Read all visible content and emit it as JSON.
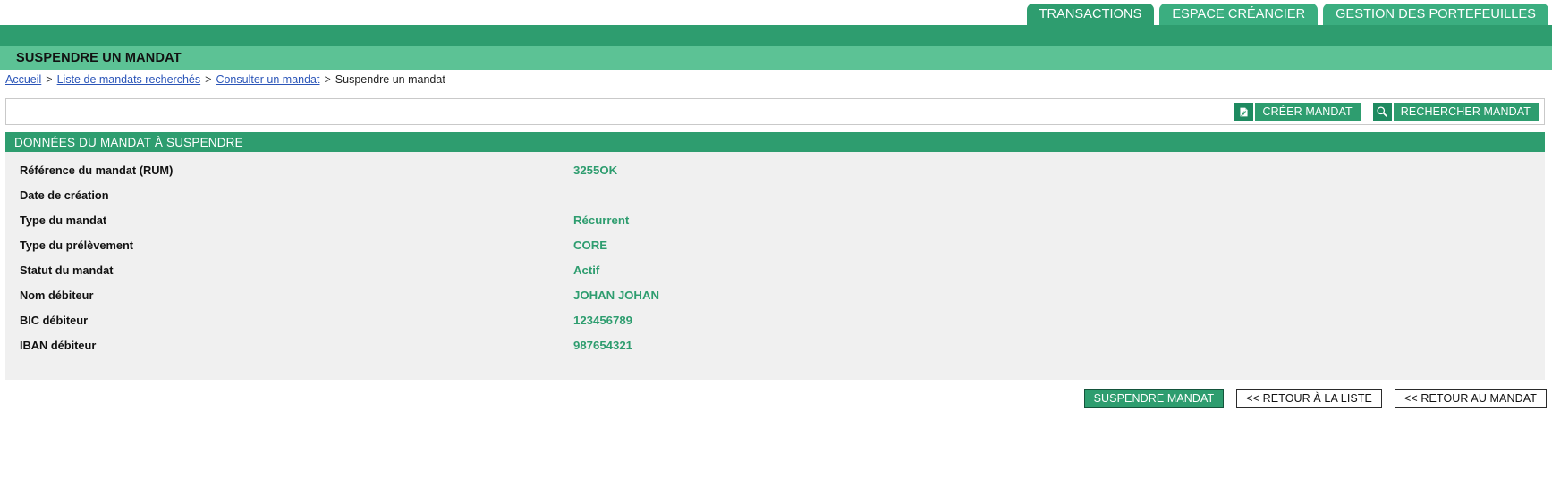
{
  "theme": {
    "green_dark": "#2e9d6f",
    "green_mid": "#3bae80",
    "green_light": "#5cc295",
    "panel_gray": "#f0f0f0",
    "link_blue": "#2b55b8"
  },
  "nav": {
    "tabs": [
      {
        "label": "TRANSACTIONS",
        "active": true
      },
      {
        "label": "ESPACE CRÉANCIER",
        "active": false
      },
      {
        "label": "GESTION DES PORTEFEUILLES",
        "active": false
      }
    ]
  },
  "page": {
    "title": "SUSPENDRE UN MANDAT"
  },
  "breadcrumb": {
    "items": [
      {
        "label": "Accueil",
        "link": true
      },
      {
        "label": "Liste de mandats recherchés",
        "link": true
      },
      {
        "label": "Consulter un mandat",
        "link": true
      },
      {
        "label": "Suspendre un mandat",
        "link": false
      }
    ],
    "separator": ">"
  },
  "toolbar": {
    "create_label": "CRÉER MANDAT",
    "create_icon": "document-icon",
    "search_label": "RECHERCHER MANDAT",
    "search_icon": "search-icon"
  },
  "section": {
    "header": "DONNÉES DU MANDAT À SUSPENDRE",
    "rows": [
      {
        "label": "Référence du mandat (RUM)",
        "value": "3255OK"
      },
      {
        "label": "Date de création",
        "value": ""
      },
      {
        "label": "Type du mandat",
        "value": "Récurrent"
      },
      {
        "label": "Type du prélèvement",
        "value": "CORE"
      },
      {
        "label": "Statut du mandat",
        "value": "Actif"
      },
      {
        "label": "Nom débiteur",
        "value": "JOHAN JOHAN"
      },
      {
        "label": "BIC débiteur",
        "value": "123456789"
      },
      {
        "label": "IBAN débiteur",
        "value": "987654321"
      }
    ]
  },
  "footer": {
    "suspend_label": "SUSPENDRE MANDAT",
    "back_to_list_label": "<< RETOUR À LA LISTE",
    "back_to_mandate_label": "<< RETOUR AU MANDAT"
  }
}
